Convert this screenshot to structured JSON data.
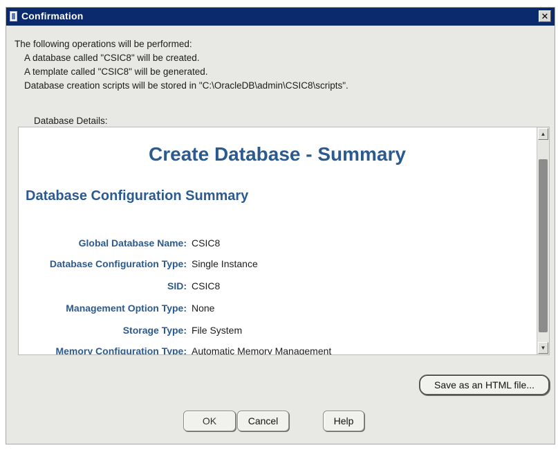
{
  "window": {
    "title": "Confirmation",
    "close_glyph": "✕"
  },
  "intro": {
    "heading": "The following operations will be performed:",
    "lines": [
      "A database called \"CSIC8\" will be created.",
      "A template called \"CSIC8\" will be generated.",
      "Database creation scripts will be stored in \"C:\\OracleDB\\admin\\CSIC8\\scripts\"."
    ]
  },
  "details_label": "Database Details:",
  "summary": {
    "title": "Create Database - Summary",
    "section_title": "Database Configuration Summary",
    "rows": [
      {
        "key": "Global Database Name:",
        "value": "CSIC8"
      },
      {
        "key": "Database Configuration Type:",
        "value": "Single Instance"
      },
      {
        "key": "SID:",
        "value": "CSIC8"
      },
      {
        "key": "Management Option Type:",
        "value": "None"
      },
      {
        "key": "Storage Type:",
        "value": "File System"
      },
      {
        "key": "Memory Configuration Type:",
        "value": "Automatic Memory Management"
      }
    ]
  },
  "buttons": {
    "save_html": "Save as an HTML file...",
    "ok": "OK",
    "cancel": "Cancel",
    "help": "Help"
  },
  "scrollbar": {
    "up_glyph": "▲",
    "down_glyph": "▼"
  },
  "icons": {
    "title_icon": "window-app-icon",
    "close_icon": "close-icon"
  },
  "colors": {
    "titlebar": "#0b2a6e",
    "accent_text": "#2a5a90",
    "dialog_bg": "#e8e8e4"
  }
}
